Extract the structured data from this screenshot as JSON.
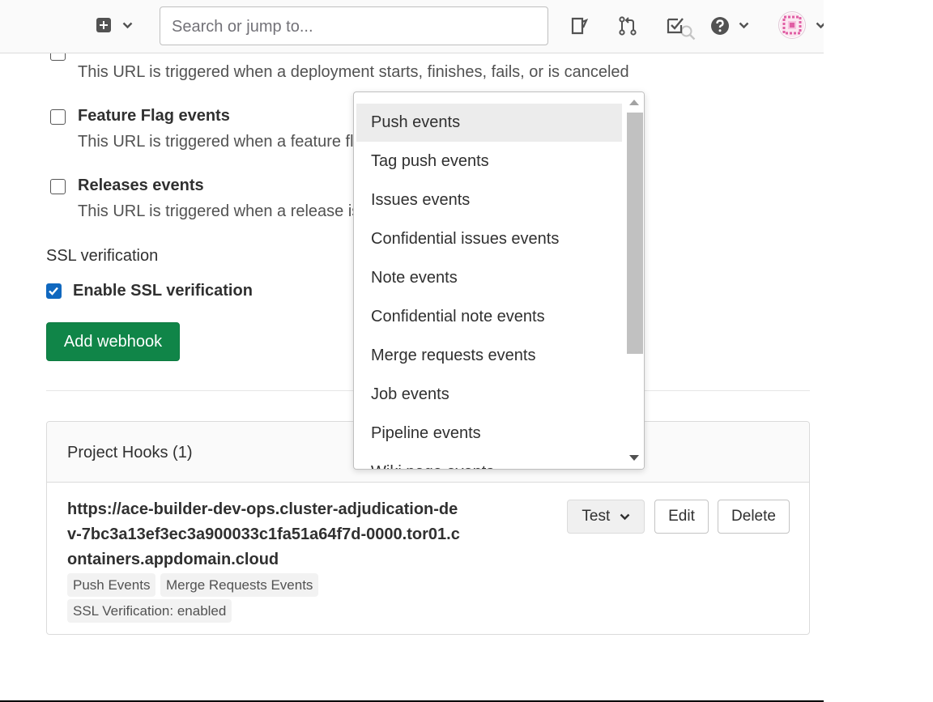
{
  "navbar": {
    "search_placeholder": "Search or jump to..."
  },
  "form": {
    "deployment_desc": "This URL is triggered when a deployment starts, finishes, fails, or is canceled",
    "feature_flag_label": "Feature Flag events",
    "feature_flag_desc": "This URL is triggered when a feature flag is toggled",
    "releases_label": "Releases events",
    "releases_desc": "This URL is triggered when a release is created or updated",
    "ssl_heading": "SSL verification",
    "ssl_checkbox_label": "Enable SSL verification",
    "ssl_checked": true,
    "add_webhook_label": "Add webhook"
  },
  "hooks": {
    "title": "Project Hooks (1)",
    "url": "https://ace-builder-dev-ops.cluster-adjudication-dev-7bc3a13ef3ec3a900033c1fa51a64f7d-0000.tor01.containers.appdomain.cloud",
    "badges": [
      "Push Events",
      "Merge Requests Events",
      "SSL Verification: enabled"
    ],
    "test_label": "Test",
    "edit_label": "Edit",
    "delete_label": "Delete"
  },
  "dropdown": {
    "selected": "Push events",
    "items": [
      "Push events",
      "Tag push events",
      "Issues events",
      "Confidential issues events",
      "Note events",
      "Confidential note events",
      "Merge requests events",
      "Job events",
      "Pipeline events",
      "Wiki page events"
    ]
  },
  "colors": {
    "primary_button": "#108548",
    "checkbox_checked": "#1068bf",
    "selected_item_bg": "#ececec"
  }
}
